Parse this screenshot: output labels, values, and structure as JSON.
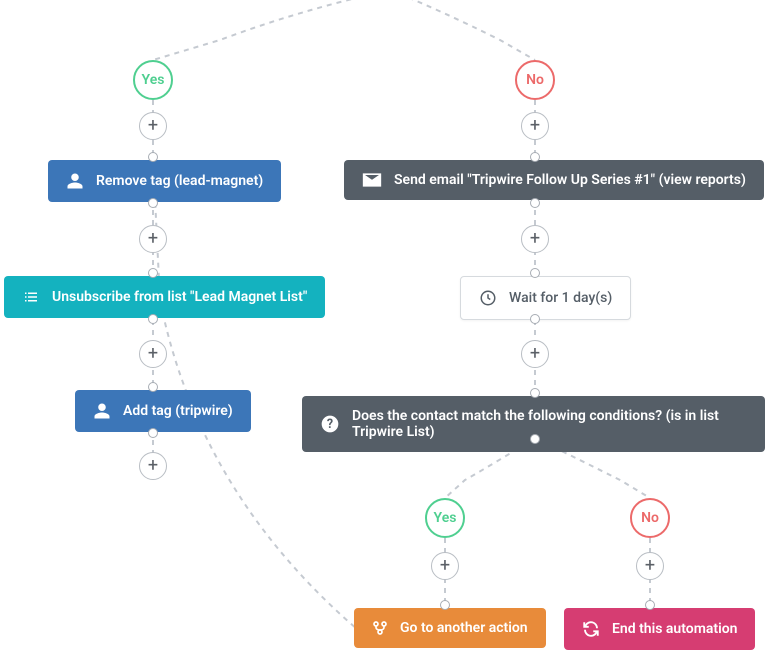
{
  "branches": {
    "left": {
      "label": "Yes",
      "actions": [
        {
          "label": "Remove tag (lead-magnet)"
        },
        {
          "label": "Unsubscribe from list \"Lead Magnet List\""
        },
        {
          "label": "Add tag (tripwire)"
        }
      ]
    },
    "right": {
      "label": "No",
      "actions": [
        {
          "label": "Send email \"Tripwire Follow Up Series #1\" (view reports)"
        },
        {
          "label": "Wait for 1 day(s)"
        },
        {
          "label": "Does the contact match the following conditions? (is in list Tripwire List)"
        }
      ],
      "sub_branches": {
        "yes": {
          "label": "Yes",
          "action": {
            "label": "Go to another action"
          }
        },
        "no": {
          "label": "No",
          "action": {
            "label": "End this automation"
          }
        }
      }
    }
  }
}
